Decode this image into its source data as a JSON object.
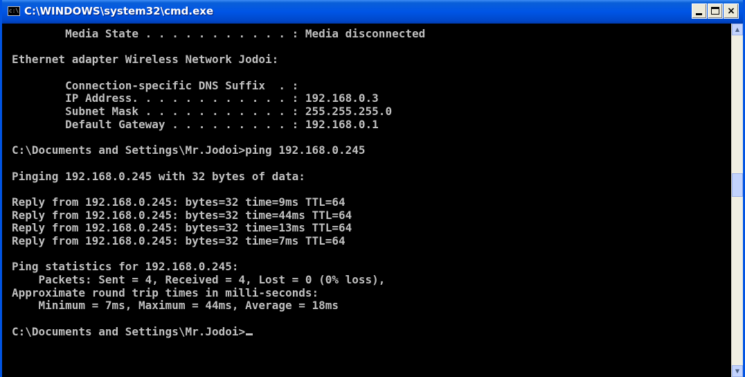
{
  "window": {
    "title": "C:\\WINDOWS\\system32\\cmd.exe",
    "app_icon": "cmd-icon",
    "buttons": {
      "minimize_icon": "minimize-icon",
      "maximize_icon": "maximize-icon",
      "close_label": "×"
    }
  },
  "colors": {
    "titlebar": "#0055e5",
    "console_bg": "#000000",
    "console_text": "#c0c0c0",
    "scrollbar_track": "#f1efe2",
    "scrollbar_thumb": "#c3d3fd"
  },
  "console": {
    "lines": [
      "        Media State . . . . . . . . . . . : Media disconnected",
      "",
      "Ethernet adapter Wireless Network Jodoi:",
      "",
      "        Connection-specific DNS Suffix  . :",
      "        IP Address. . . . . . . . . . . . : 192.168.0.3",
      "        Subnet Mask . . . . . . . . . . . : 255.255.255.0",
      "        Default Gateway . . . . . . . . . : 192.168.0.1",
      "",
      "C:\\Documents and Settings\\Mr.Jodoi>ping 192.168.0.245",
      "",
      "Pinging 192.168.0.245 with 32 bytes of data:",
      "",
      "Reply from 192.168.0.245: bytes=32 time=9ms TTL=64",
      "Reply from 192.168.0.245: bytes=32 time=44ms TTL=64",
      "Reply from 192.168.0.245: bytes=32 time=13ms TTL=64",
      "Reply from 192.168.0.245: bytes=32 time=7ms TTL=64",
      "",
      "Ping statistics for 192.168.0.245:",
      "    Packets: Sent = 4, Received = 4, Lost = 0 (0% loss),",
      "Approximate round trip times in milli-seconds:",
      "    Minimum = 7ms, Maximum = 44ms, Average = 18ms",
      "",
      "C:\\Documents and Settings\\Mr.Jodoi>"
    ]
  },
  "scrollbar": {
    "up_arrow": "▲",
    "down_arrow": "▼",
    "position": 0.45
  }
}
